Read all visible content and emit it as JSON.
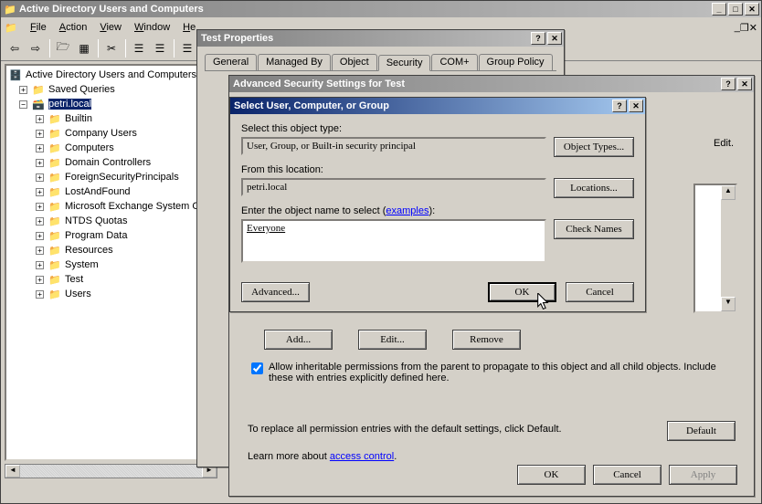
{
  "main_window": {
    "title": "Active Directory Users and Computers",
    "menubar": [
      "File",
      "Action",
      "View",
      "Window",
      "Help"
    ],
    "tree": {
      "root": "Active Directory Users and Computers",
      "saved_queries": "Saved Queries",
      "domain": "petri.local",
      "nodes": [
        "Builtin",
        "Company Users",
        "Computers",
        "Domain Controllers",
        "ForeignSecurityPrincipals",
        "LostAndFound",
        "Microsoft Exchange System Ob",
        "NTDS Quotas",
        "Program Data",
        "Resources",
        "System",
        "Test",
        "Users"
      ]
    }
  },
  "test_props": {
    "title": "Test Properties",
    "tabs": [
      "General",
      "Managed By",
      "Object",
      "Security",
      "COM+",
      "Group Policy"
    ]
  },
  "adv_sec": {
    "title": "Advanced Security Settings for Test",
    "edit_label": "Edit.",
    "add_btn": "Add...",
    "edit_btn": "Edit...",
    "remove_btn": "Remove",
    "inherit_text": "Allow inheritable permissions from the parent to propagate to this object and all child objects. Include these with entries explicitly defined here.",
    "replace_text": "To replace all permission entries with the default settings, click Default.",
    "default_btn": "Default",
    "learn_prefix": "Learn more about ",
    "learn_link": "access control",
    "ok": "OK",
    "cancel": "Cancel",
    "apply": "Apply"
  },
  "select_dlg": {
    "title": "Select User, Computer, or Group",
    "obj_type_label": "Select this object type:",
    "obj_type_value": "User, Group, or Built-in security principal",
    "obj_types_btn": "Object Types...",
    "location_label": "From this location:",
    "location_value": "petri.local",
    "locations_btn": "Locations...",
    "name_label_prefix": "Enter the object name to select (",
    "name_label_link": "examples",
    "name_label_suffix": "):",
    "name_value": "Everyone",
    "check_names_btn": "Check Names",
    "advanced_btn": "Advanced...",
    "ok": "OK",
    "cancel": "Cancel"
  }
}
